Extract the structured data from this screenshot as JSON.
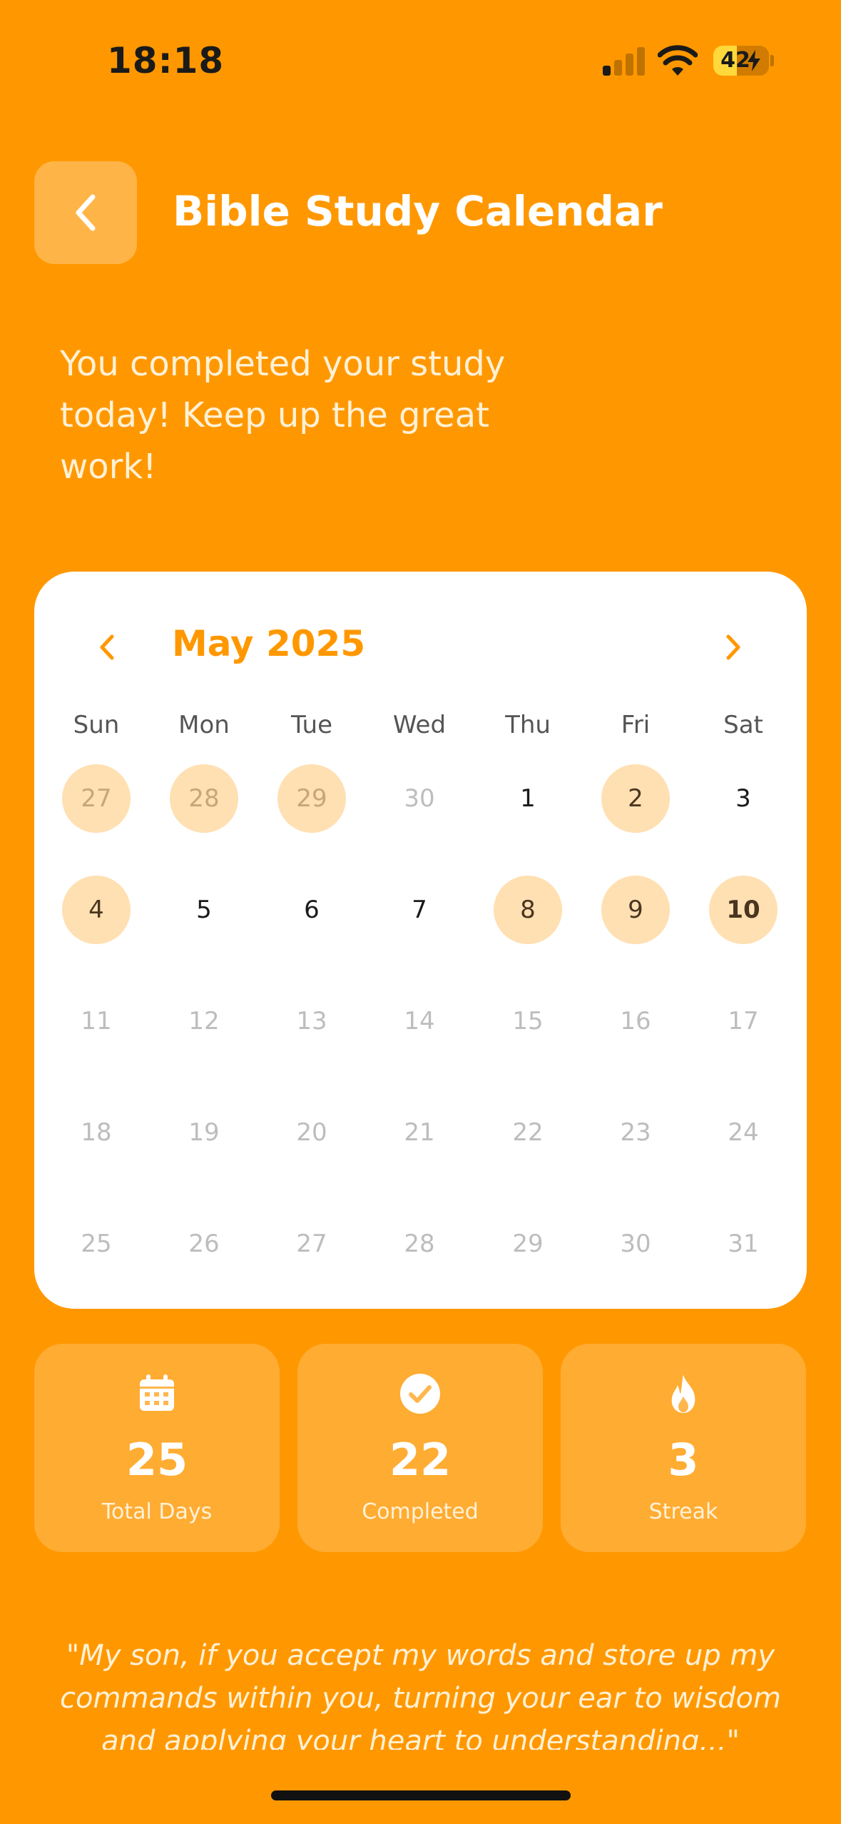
{
  "status": {
    "time": "18:18",
    "battery": "42"
  },
  "header": {
    "title": "Bible Study Calendar"
  },
  "message": "You completed your study today! Keep up the great work!",
  "calendar": {
    "month_label": "May 2025",
    "weekdays": [
      "Sun",
      "Mon",
      "Tue",
      "Wed",
      "Thu",
      "Fri",
      "Sat"
    ],
    "weeks": [
      [
        {
          "day": "27",
          "type": "muted",
          "done": true
        },
        {
          "day": "28",
          "type": "muted",
          "done": true
        },
        {
          "day": "29",
          "type": "muted",
          "done": true
        },
        {
          "day": "30",
          "type": "muted",
          "done": false
        },
        {
          "day": "1",
          "type": "current",
          "done": false
        },
        {
          "day": "2",
          "type": "current",
          "done": true
        },
        {
          "day": "3",
          "type": "current",
          "done": false
        }
      ],
      [
        {
          "day": "4",
          "type": "current",
          "done": true
        },
        {
          "day": "5",
          "type": "current",
          "done": false
        },
        {
          "day": "6",
          "type": "current",
          "done": false
        },
        {
          "day": "7",
          "type": "current",
          "done": false
        },
        {
          "day": "8",
          "type": "current",
          "done": true
        },
        {
          "day": "9",
          "type": "current",
          "done": true
        },
        {
          "day": "10",
          "type": "today",
          "done": true
        }
      ],
      [
        {
          "day": "11",
          "type": "muted",
          "done": false
        },
        {
          "day": "12",
          "type": "muted",
          "done": false
        },
        {
          "day": "13",
          "type": "muted",
          "done": false
        },
        {
          "day": "14",
          "type": "muted",
          "done": false
        },
        {
          "day": "15",
          "type": "muted",
          "done": false
        },
        {
          "day": "16",
          "type": "muted",
          "done": false
        },
        {
          "day": "17",
          "type": "muted",
          "done": false
        }
      ],
      [
        {
          "day": "18",
          "type": "muted",
          "done": false
        },
        {
          "day": "19",
          "type": "muted",
          "done": false
        },
        {
          "day": "20",
          "type": "muted",
          "done": false
        },
        {
          "day": "21",
          "type": "muted",
          "done": false
        },
        {
          "day": "22",
          "type": "muted",
          "done": false
        },
        {
          "day": "23",
          "type": "muted",
          "done": false
        },
        {
          "day": "24",
          "type": "muted",
          "done": false
        }
      ],
      [
        {
          "day": "25",
          "type": "muted",
          "done": false
        },
        {
          "day": "26",
          "type": "muted",
          "done": false
        },
        {
          "day": "27",
          "type": "muted",
          "done": false
        },
        {
          "day": "28",
          "type": "muted",
          "done": false
        },
        {
          "day": "29",
          "type": "muted",
          "done": false
        },
        {
          "day": "30",
          "type": "muted",
          "done": false
        },
        {
          "day": "31",
          "type": "muted",
          "done": false
        }
      ]
    ]
  },
  "stats": [
    {
      "icon": "calendar-icon",
      "value": "25",
      "label": "Total Days"
    },
    {
      "icon": "check-circle-icon",
      "value": "22",
      "label": "Completed"
    },
    {
      "icon": "flame-icon",
      "value": "3",
      "label": "Streak"
    }
  ],
  "verse": "\"My son, if you accept my words and store up my commands within you, turning your ear to wisdom and applying your heart to understanding...\"",
  "colors": {
    "background": "#FF9800",
    "accent": "#FF9800",
    "completed_day": "#FFE0B2",
    "card": "#FFFFFF"
  }
}
